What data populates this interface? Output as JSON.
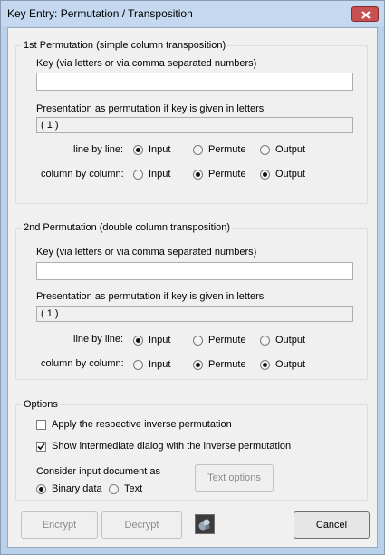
{
  "window": {
    "title": "Key Entry: Permutation / Transposition",
    "close_label": "✕"
  },
  "perm1": {
    "legend": "1st Permutation (simple column transposition)",
    "key_label": "Key (via letters or via comma separated numbers)",
    "key_value": "",
    "presentation_label": "Presentation as permutation if key is given in letters",
    "presentation_value": "( 1 )",
    "line_label": "line by line:",
    "column_label": "column by column:",
    "line_selected": "Input",
    "column_selected": "Permute / Output",
    "options": {
      "input": "Input",
      "permute": "Permute",
      "output": "Output"
    }
  },
  "perm2": {
    "legend": "2nd Permutation (double column transposition)",
    "key_label": "Key (via letters or via comma separated numbers)",
    "key_value": "",
    "presentation_label": "Presentation as permutation if key is given in letters",
    "presentation_value": "( 1 )",
    "line_label": "line by line:",
    "column_label": "column by column:",
    "options": {
      "input": "Input",
      "permute": "Permute",
      "output": "Output"
    }
  },
  "options_group": {
    "legend": "Options",
    "apply_inverse": {
      "label": "Apply the respective inverse permutation",
      "checked": false
    },
    "show_dialog": {
      "label": "Show intermediate dialog with the inverse permutation",
      "checked": true
    },
    "consider_label": "Consider input document as",
    "binary_label": "Binary data",
    "text_label": "Text",
    "text_options_label": "Text options"
  },
  "buttons": {
    "encrypt": "Encrypt",
    "decrypt": "Decrypt",
    "cancel": "Cancel"
  }
}
